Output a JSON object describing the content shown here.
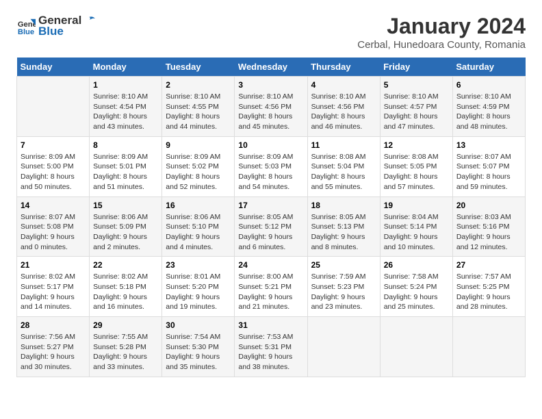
{
  "logo": {
    "general": "General",
    "blue": "Blue"
  },
  "title": "January 2024",
  "subtitle": "Cerbal, Hunedoara County, Romania",
  "days_of_week": [
    "Sunday",
    "Monday",
    "Tuesday",
    "Wednesday",
    "Thursday",
    "Friday",
    "Saturday"
  ],
  "weeks": [
    [
      {
        "day": "",
        "sunrise": "",
        "sunset": "",
        "daylight": ""
      },
      {
        "day": "1",
        "sunrise": "Sunrise: 8:10 AM",
        "sunset": "Sunset: 4:54 PM",
        "daylight": "Daylight: 8 hours and 43 minutes."
      },
      {
        "day": "2",
        "sunrise": "Sunrise: 8:10 AM",
        "sunset": "Sunset: 4:55 PM",
        "daylight": "Daylight: 8 hours and 44 minutes."
      },
      {
        "day": "3",
        "sunrise": "Sunrise: 8:10 AM",
        "sunset": "Sunset: 4:56 PM",
        "daylight": "Daylight: 8 hours and 45 minutes."
      },
      {
        "day": "4",
        "sunrise": "Sunrise: 8:10 AM",
        "sunset": "Sunset: 4:56 PM",
        "daylight": "Daylight: 8 hours and 46 minutes."
      },
      {
        "day": "5",
        "sunrise": "Sunrise: 8:10 AM",
        "sunset": "Sunset: 4:57 PM",
        "daylight": "Daylight: 8 hours and 47 minutes."
      },
      {
        "day": "6",
        "sunrise": "Sunrise: 8:10 AM",
        "sunset": "Sunset: 4:59 PM",
        "daylight": "Daylight: 8 hours and 48 minutes."
      }
    ],
    [
      {
        "day": "7",
        "sunrise": "Sunrise: 8:09 AM",
        "sunset": "Sunset: 5:00 PM",
        "daylight": "Daylight: 8 hours and 50 minutes."
      },
      {
        "day": "8",
        "sunrise": "Sunrise: 8:09 AM",
        "sunset": "Sunset: 5:01 PM",
        "daylight": "Daylight: 8 hours and 51 minutes."
      },
      {
        "day": "9",
        "sunrise": "Sunrise: 8:09 AM",
        "sunset": "Sunset: 5:02 PM",
        "daylight": "Daylight: 8 hours and 52 minutes."
      },
      {
        "day": "10",
        "sunrise": "Sunrise: 8:09 AM",
        "sunset": "Sunset: 5:03 PM",
        "daylight": "Daylight: 8 hours and 54 minutes."
      },
      {
        "day": "11",
        "sunrise": "Sunrise: 8:08 AM",
        "sunset": "Sunset: 5:04 PM",
        "daylight": "Daylight: 8 hours and 55 minutes."
      },
      {
        "day": "12",
        "sunrise": "Sunrise: 8:08 AM",
        "sunset": "Sunset: 5:05 PM",
        "daylight": "Daylight: 8 hours and 57 minutes."
      },
      {
        "day": "13",
        "sunrise": "Sunrise: 8:07 AM",
        "sunset": "Sunset: 5:07 PM",
        "daylight": "Daylight: 8 hours and 59 minutes."
      }
    ],
    [
      {
        "day": "14",
        "sunrise": "Sunrise: 8:07 AM",
        "sunset": "Sunset: 5:08 PM",
        "daylight": "Daylight: 9 hours and 0 minutes."
      },
      {
        "day": "15",
        "sunrise": "Sunrise: 8:06 AM",
        "sunset": "Sunset: 5:09 PM",
        "daylight": "Daylight: 9 hours and 2 minutes."
      },
      {
        "day": "16",
        "sunrise": "Sunrise: 8:06 AM",
        "sunset": "Sunset: 5:10 PM",
        "daylight": "Daylight: 9 hours and 4 minutes."
      },
      {
        "day": "17",
        "sunrise": "Sunrise: 8:05 AM",
        "sunset": "Sunset: 5:12 PM",
        "daylight": "Daylight: 9 hours and 6 minutes."
      },
      {
        "day": "18",
        "sunrise": "Sunrise: 8:05 AM",
        "sunset": "Sunset: 5:13 PM",
        "daylight": "Daylight: 9 hours and 8 minutes."
      },
      {
        "day": "19",
        "sunrise": "Sunrise: 8:04 AM",
        "sunset": "Sunset: 5:14 PM",
        "daylight": "Daylight: 9 hours and 10 minutes."
      },
      {
        "day": "20",
        "sunrise": "Sunrise: 8:03 AM",
        "sunset": "Sunset: 5:16 PM",
        "daylight": "Daylight: 9 hours and 12 minutes."
      }
    ],
    [
      {
        "day": "21",
        "sunrise": "Sunrise: 8:02 AM",
        "sunset": "Sunset: 5:17 PM",
        "daylight": "Daylight: 9 hours and 14 minutes."
      },
      {
        "day": "22",
        "sunrise": "Sunrise: 8:02 AM",
        "sunset": "Sunset: 5:18 PM",
        "daylight": "Daylight: 9 hours and 16 minutes."
      },
      {
        "day": "23",
        "sunrise": "Sunrise: 8:01 AM",
        "sunset": "Sunset: 5:20 PM",
        "daylight": "Daylight: 9 hours and 19 minutes."
      },
      {
        "day": "24",
        "sunrise": "Sunrise: 8:00 AM",
        "sunset": "Sunset: 5:21 PM",
        "daylight": "Daylight: 9 hours and 21 minutes."
      },
      {
        "day": "25",
        "sunrise": "Sunrise: 7:59 AM",
        "sunset": "Sunset: 5:23 PM",
        "daylight": "Daylight: 9 hours and 23 minutes."
      },
      {
        "day": "26",
        "sunrise": "Sunrise: 7:58 AM",
        "sunset": "Sunset: 5:24 PM",
        "daylight": "Daylight: 9 hours and 25 minutes."
      },
      {
        "day": "27",
        "sunrise": "Sunrise: 7:57 AM",
        "sunset": "Sunset: 5:25 PM",
        "daylight": "Daylight: 9 hours and 28 minutes."
      }
    ],
    [
      {
        "day": "28",
        "sunrise": "Sunrise: 7:56 AM",
        "sunset": "Sunset: 5:27 PM",
        "daylight": "Daylight: 9 hours and 30 minutes."
      },
      {
        "day": "29",
        "sunrise": "Sunrise: 7:55 AM",
        "sunset": "Sunset: 5:28 PM",
        "daylight": "Daylight: 9 hours and 33 minutes."
      },
      {
        "day": "30",
        "sunrise": "Sunrise: 7:54 AM",
        "sunset": "Sunset: 5:30 PM",
        "daylight": "Daylight: 9 hours and 35 minutes."
      },
      {
        "day": "31",
        "sunrise": "Sunrise: 7:53 AM",
        "sunset": "Sunset: 5:31 PM",
        "daylight": "Daylight: 9 hours and 38 minutes."
      },
      {
        "day": "",
        "sunrise": "",
        "sunset": "",
        "daylight": ""
      },
      {
        "day": "",
        "sunrise": "",
        "sunset": "",
        "daylight": ""
      },
      {
        "day": "",
        "sunrise": "",
        "sunset": "",
        "daylight": ""
      }
    ]
  ],
  "header_bg": "#2a6cb5"
}
